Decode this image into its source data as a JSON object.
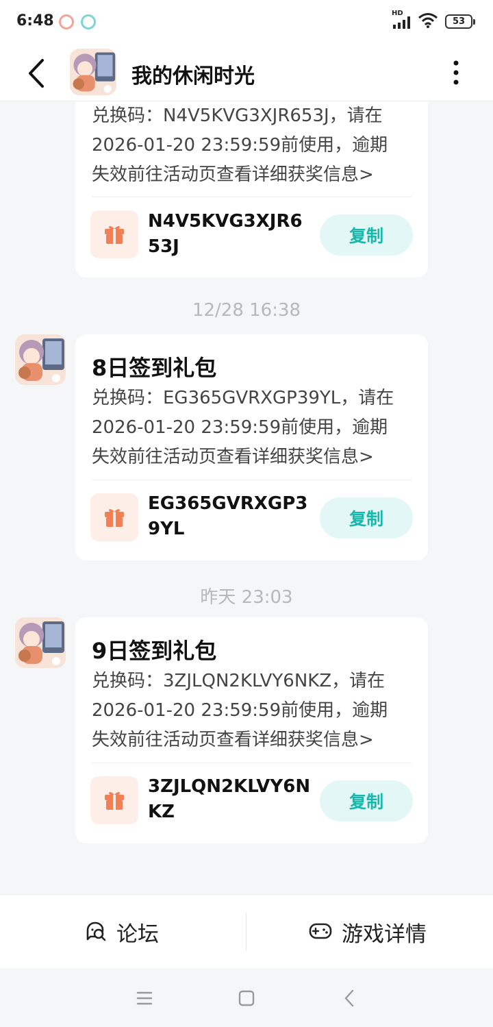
{
  "status_bar": {
    "time": "6:48",
    "network": "HD",
    "battery": "53"
  },
  "header": {
    "title": "我的休闲时光"
  },
  "messages": [
    {
      "title": "",
      "body": "兑换码：N4V5KVG3XJR653J，请在\n2026-01-20 23:59:59前使用，逾期\n失效前往活动页查看详细获奖信息>",
      "code": "N4V5KVG3XJR653J",
      "copy_label": "复制"
    },
    {
      "time": "12/28  16:38",
      "title": "8日签到礼包",
      "body": "兑换码：EG365GVRXGP39YL，请在\n2026-01-20 23:59:59前使用，逾期\n失效前往活动页查看详细获奖信息>",
      "code": "EG365GVRXGP39YL",
      "copy_label": "复制"
    },
    {
      "time": "昨天  23:03",
      "title": "9日签到礼包",
      "body": "兑换码：3ZJLQN2KLVY6NKZ，请在\n2026-01-20 23:59:59前使用，逾期\n失效前往活动页查看详细获奖信息>",
      "code": "3ZJLQN2KLVY6NKZ",
      "copy_label": "复制"
    }
  ],
  "bottom_bar": {
    "forum_label": "论坛",
    "game_detail_label": "游戏详情"
  },
  "icons": [
    "back-arrow-icon",
    "more-vertical-icon",
    "gift-icon",
    "forum-icon",
    "gamepad-icon",
    "menu-icon",
    "home-icon",
    "back-icon"
  ],
  "colors": {
    "accent": "#17b7ac",
    "copy_bg": "#e3f8f6",
    "gift": "#f08055",
    "gift_bg": "#fdeee8"
  }
}
